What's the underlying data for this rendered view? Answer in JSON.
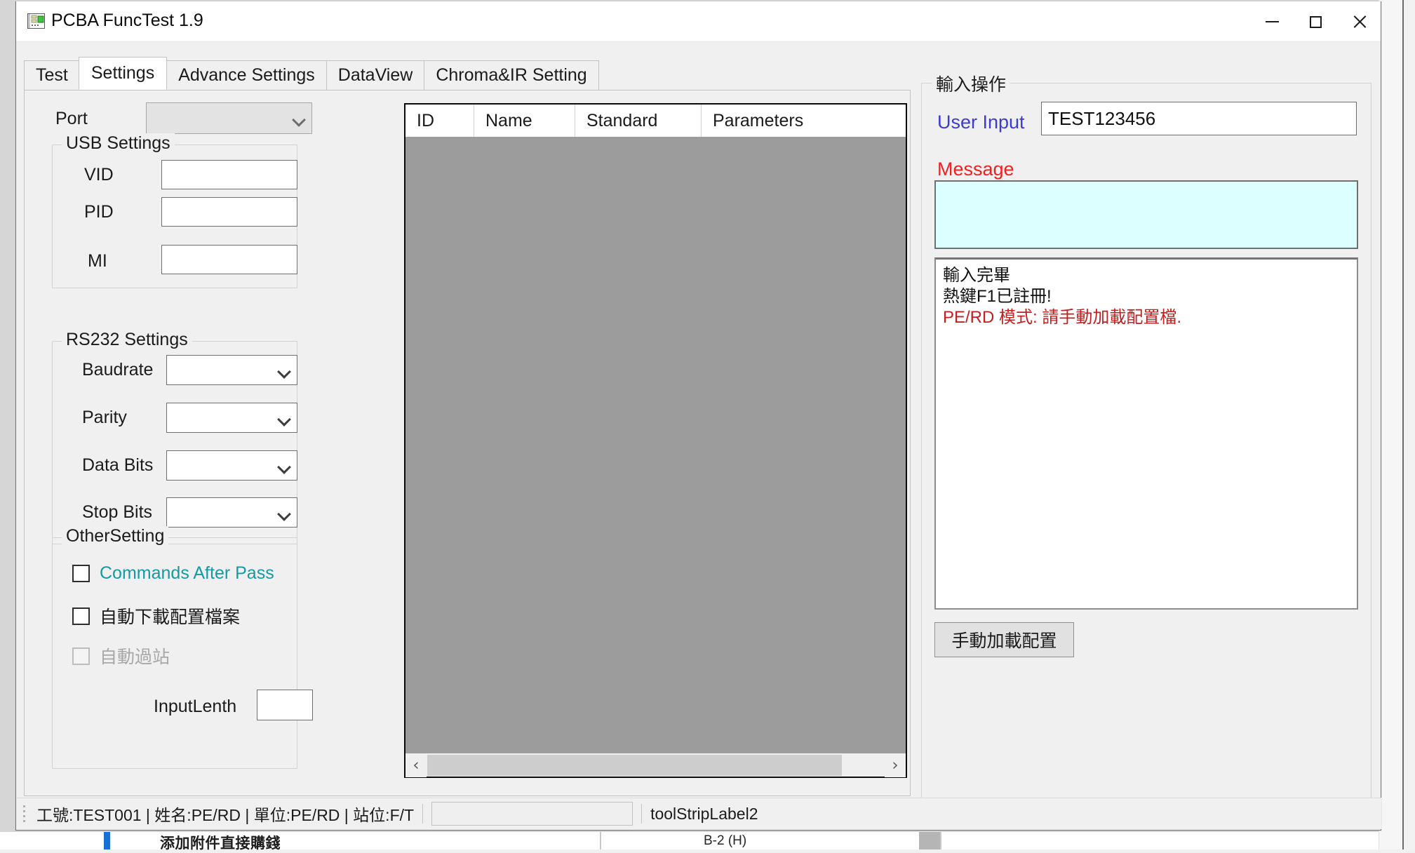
{
  "window": {
    "title": "PCBA FuncTest 1.9",
    "icon": "pcb-card-icon",
    "minimize_label": "—",
    "maximize_label": "□",
    "close_label": "✕"
  },
  "tabs": [
    {
      "label": "Test",
      "active": false
    },
    {
      "label": "Settings",
      "active": true
    },
    {
      "label": "Advance Settings",
      "active": false
    },
    {
      "label": "DataView",
      "active": false
    },
    {
      "label": "Chroma&IR Setting",
      "active": false
    }
  ],
  "settings": {
    "port": {
      "label": "Port",
      "value": "",
      "enabled": false
    },
    "usb_group": {
      "title": "USB Settings",
      "fields": [
        {
          "label": "VID",
          "value": ""
        },
        {
          "label": "PID",
          "value": ""
        },
        {
          "label": "MI",
          "value": ""
        }
      ]
    },
    "rs232_group": {
      "title": "RS232 Settings",
      "fields": [
        {
          "label": "Baudrate",
          "value": ""
        },
        {
          "label": "Parity",
          "value": ""
        },
        {
          "label": "Data Bits",
          "value": ""
        },
        {
          "label": "Stop Bits",
          "value": ""
        }
      ]
    },
    "other_group": {
      "title": "OtherSetting",
      "checkboxes": [
        {
          "label": "Commands After Pass",
          "checked": false,
          "enabled": true,
          "color": "#149aa5"
        },
        {
          "label": "自動下載配置檔案",
          "checked": false,
          "enabled": true,
          "color": "#1b1b1b"
        },
        {
          "label": "自動過站",
          "checked": false,
          "enabled": false,
          "color": "#a8a8a8"
        }
      ],
      "input_lenth": {
        "label": "InputLenth",
        "value": ""
      }
    }
  },
  "grid": {
    "columns": [
      "ID",
      "Name",
      "Standard",
      "Parameters"
    ],
    "rows": [],
    "hscroll": {
      "left_arrow": "‹",
      "right_arrow": "›"
    }
  },
  "input_operation": {
    "title": "輸入操作",
    "user_input": {
      "label": "User Input",
      "value": "TEST123456",
      "label_color": "#3c3cd0"
    },
    "message": {
      "label": "Message",
      "value": "",
      "label_color": "#ef2020",
      "background": "#dcffff"
    },
    "log": [
      {
        "text": "輸入完畢",
        "color": "#101010"
      },
      {
        "text": "熱鍵F1已註冊!",
        "color": "#101010"
      },
      {
        "text": "PE/RD 模式: 請手動加載配置檔.",
        "color": "#c02020"
      }
    ],
    "manual_load_button": "手動加載配置"
  },
  "statusbar": {
    "info": "工號:TEST001 | 姓名:PE/RD | 單位:PE/RD | 站位:F/T",
    "progress_value": "",
    "label2": "toolStripLabel2"
  },
  "background": {
    "row_text": "添加附件直接購錢",
    "row_value": "B-2 (H)"
  }
}
